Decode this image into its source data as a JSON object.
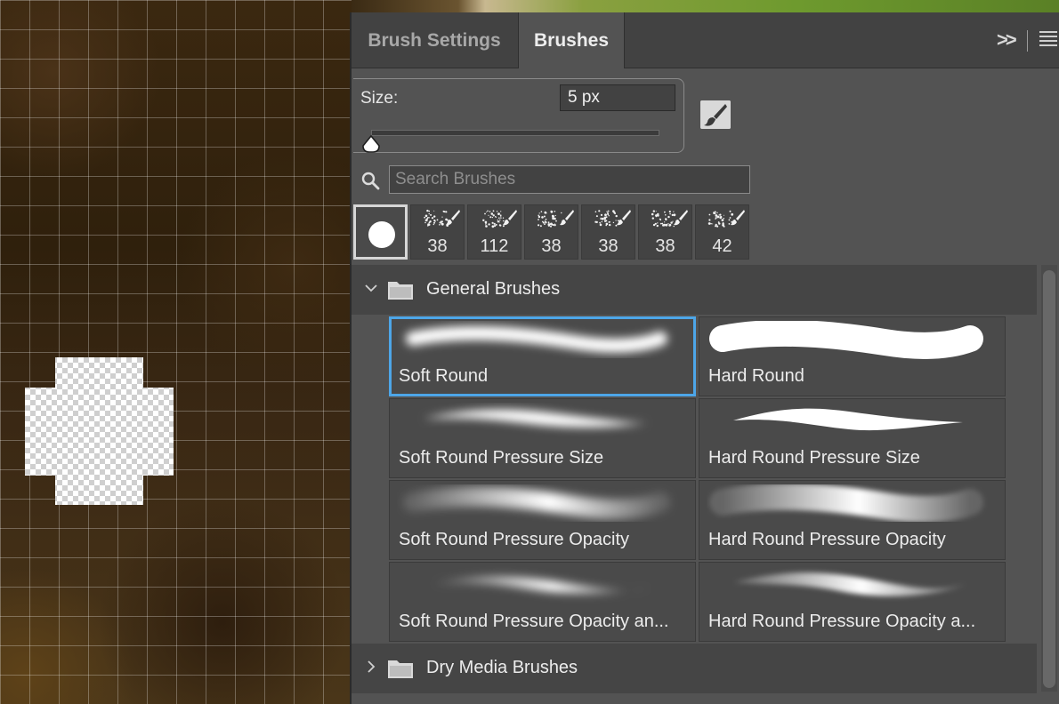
{
  "tabs": [
    {
      "label": "Brush Settings",
      "active": false
    },
    {
      "label": "Brushes",
      "active": true
    }
  ],
  "size": {
    "label": "Size:",
    "value": "5 px",
    "slider_fraction": 0.0
  },
  "search": {
    "placeholder": "Search Brushes"
  },
  "recent_brushes": [
    {
      "size": "",
      "kind": "round"
    },
    {
      "size": "38",
      "kind": "spatter"
    },
    {
      "size": "112",
      "kind": "spatter"
    },
    {
      "size": "38",
      "kind": "spatter"
    },
    {
      "size": "38",
      "kind": "spatter"
    },
    {
      "size": "38",
      "kind": "spatter"
    },
    {
      "size": "42",
      "kind": "spatter"
    }
  ],
  "groups": [
    {
      "name": "General Brushes",
      "expanded": true
    },
    {
      "name": "Dry Media Brushes",
      "expanded": false
    }
  ],
  "brushes": [
    {
      "name": "Soft Round",
      "selected": true,
      "stroke": "soft"
    },
    {
      "name": "Hard Round",
      "selected": false,
      "stroke": "hard"
    },
    {
      "name": "Soft Round Pressure Size",
      "selected": false,
      "stroke": "soft-taper"
    },
    {
      "name": "Hard Round Pressure Size",
      "selected": false,
      "stroke": "hard-taper"
    },
    {
      "name": "Soft Round Pressure Opacity",
      "selected": false,
      "stroke": "soft-opacity"
    },
    {
      "name": "Hard Round Pressure Opacity",
      "selected": false,
      "stroke": "hard-opacity"
    },
    {
      "name": "Soft Round Pressure Opacity an...",
      "selected": false,
      "stroke": "soft-opacity-size"
    },
    {
      "name": "Hard Round Pressure Opacity a...",
      "selected": false,
      "stroke": "hard-opacity-size"
    }
  ],
  "colors": {
    "selection": "#4da6e8",
    "panel": "#535353"
  },
  "icons": [
    "expand-icon",
    "panel-menu-icon",
    "brush-tool-icon",
    "search-icon",
    "chevron-down-icon",
    "chevron-right-icon",
    "folder-icon"
  ]
}
